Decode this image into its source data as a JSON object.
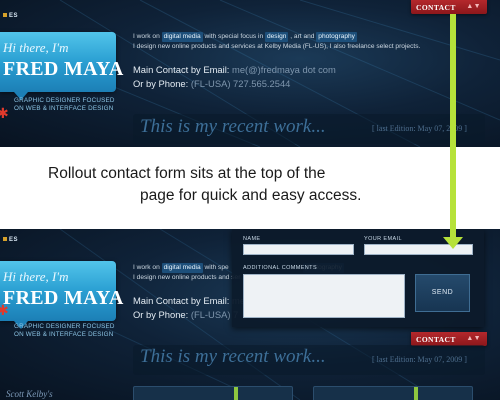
{
  "header": {
    "lang_label": "ES",
    "contact_tab": "CONTACT",
    "contact_tab_arrow": "▲▼"
  },
  "card": {
    "greeting": "Hi there, I'm",
    "name": "FRED MAYA",
    "subtitle_line1": "GRAPHIC DESIGNER FOCUSED",
    "subtitle_line2": "ON WEB & INTERFACE DESIGN"
  },
  "intro": {
    "p1_a": "I work on",
    "tag_digital": "digital media",
    "p1_b": "with special focus in",
    "tag_design": "design",
    "p1_c": ", art and",
    "tag_photo": "photography",
    "p1_d_top": "I design new online products and services at Kelby Media (FL-US), I also freelance select projects.",
    "p1_b_bottom": "with spe",
    "p1_c_bottom": "and",
    "p1_d_bottom": "I design new online products and ser"
  },
  "contact": {
    "email_label": "Main Contact by Email:",
    "email_value_top": "me(@)fredmaya dot com",
    "email_value_bottom": "me",
    "phone_label": "Or by Phone:",
    "phone_value_top": "(FL-USA) 727.565.2544",
    "phone_value_bottom": "(FL-USA) 7"
  },
  "recent": {
    "heading": "This is my recent work...",
    "last_edition_top": "[ last Edition: May 07, 2009 ]",
    "last_edition_bottom": "[ last Edition: May 07, 2009 ]"
  },
  "caption": {
    "line1": "Rollout contact form sits at the top of the",
    "line2": "page for quick and easy access."
  },
  "form": {
    "name_label": "NAME",
    "email_label": "YOUR EMAIL",
    "comments_label": "ADDITIONAL COMMENTS",
    "name_value": "",
    "email_value": "",
    "comments_value": "",
    "send_label": "SEND"
  },
  "footer": {
    "scott": "Scott Kelby's"
  },
  "colors": {
    "accent_blue": "#2a9fd2",
    "contact_red": "#b4282c",
    "arrow_green": "#b6e23a"
  }
}
